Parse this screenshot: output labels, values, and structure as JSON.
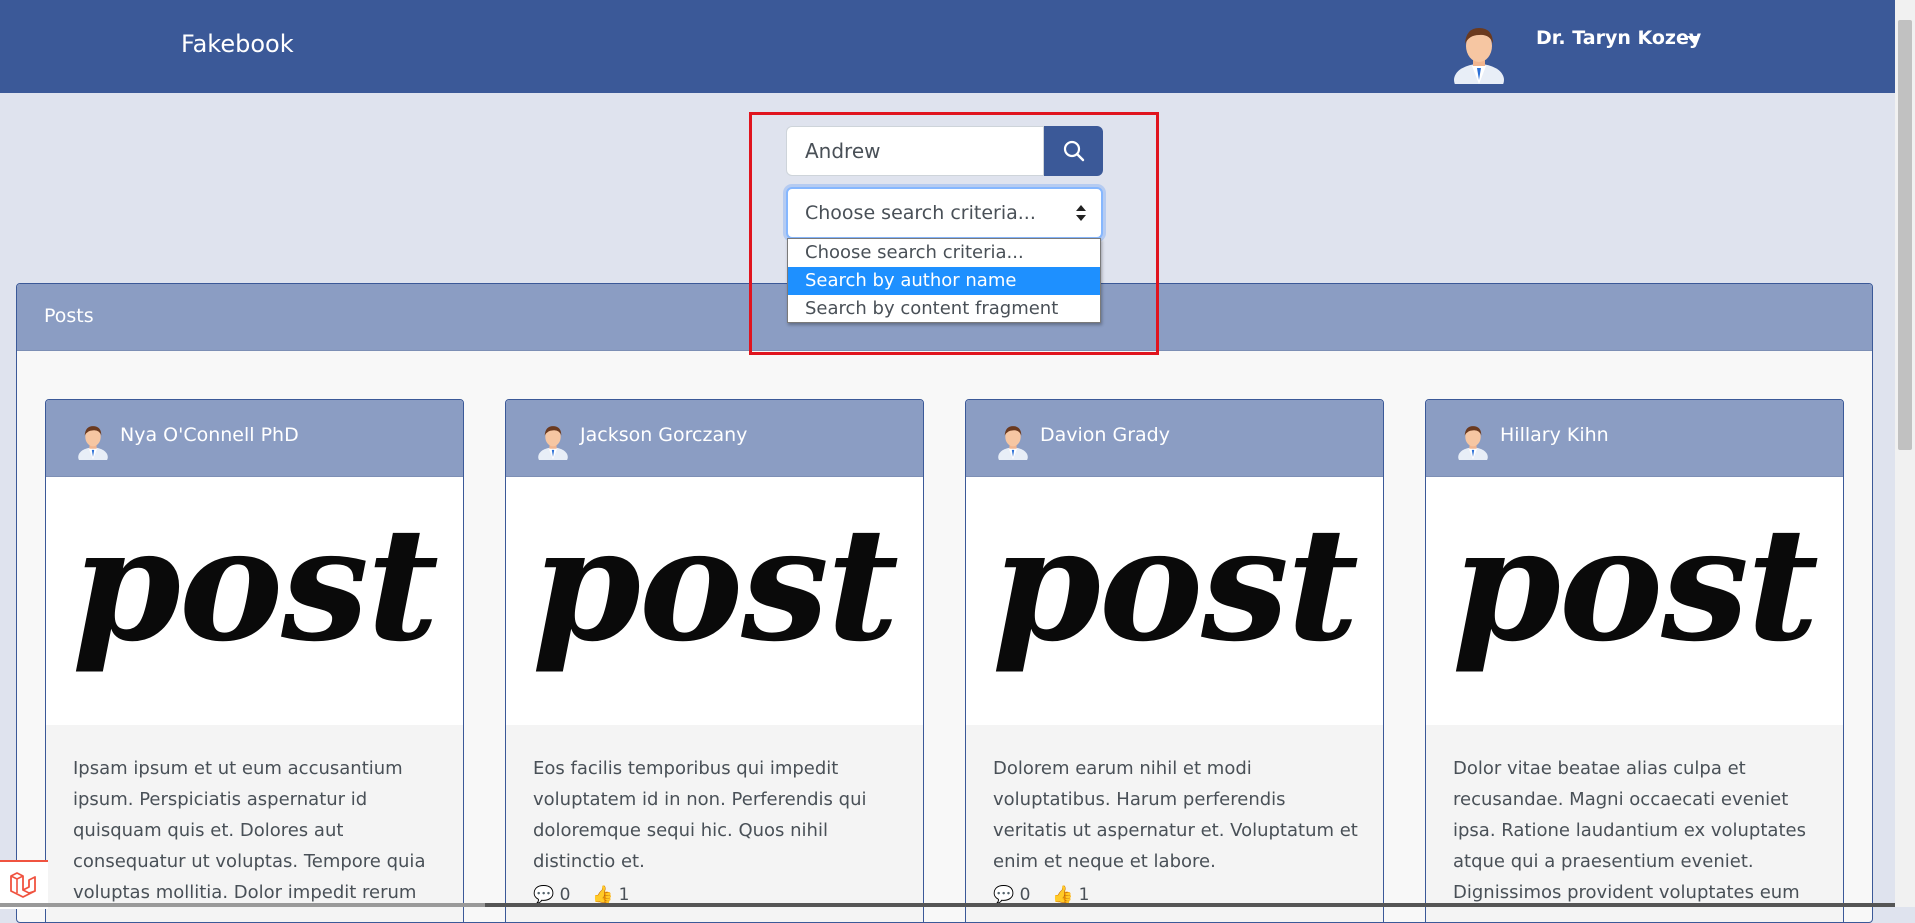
{
  "navbar": {
    "brand": "Fakebook",
    "user_name": "Dr. Taryn Kozey"
  },
  "search": {
    "query": "Andrew",
    "criteria_selected": "Choose search criteria...",
    "options": [
      "Choose search criteria...",
      "Search by author name",
      "Search by content fragment"
    ],
    "highlighted_option": "Search by author name"
  },
  "posts": {
    "title": "Posts",
    "cards": [
      {
        "author": "Nya O'Connell PhD",
        "image_text": "post",
        "text": "Ipsam ipsum et ut eum accusantium ipsum. Perspiciatis aspernatur id quisquam quis et. Dolores aut consequatur ut voluptas. Tempore quia voluptas mollitia. Dolor impedit rerum",
        "comments": "",
        "likes": ""
      },
      {
        "author": "Jackson Gorczany",
        "image_text": "post",
        "text": "Eos facilis temporibus qui impedit voluptatem id in non. Perferendis qui doloremque sequi hic. Quos nihil distinctio et.",
        "comments": "0",
        "likes": "1"
      },
      {
        "author": "Davion Grady",
        "image_text": "post",
        "text": "Dolorem earum nihil et modi voluptatibus. Harum perferendis veritatis ut aspernatur et. Voluptatum et enim et neque et labore.",
        "comments": "0",
        "likes": "1"
      },
      {
        "author": "Hillary Kihn",
        "image_text": "post",
        "text": "Dolor vitae beatae alias culpa et recusandae. Magni occaecati eveniet ipsa. Ratione laudantium ex voluptates atque qui a praesentium eveniet. Dignissimos provident voluptates eum",
        "comments": "",
        "likes": ""
      }
    ]
  },
  "colors": {
    "brand": "#3b5998",
    "header_light": "#8b9dc3",
    "background": "#dfe3ee",
    "highlight_box": "#e0141e",
    "option_selected": "#1e90ff"
  },
  "icons": {
    "search": "search-icon",
    "avatar": "avatar-icon",
    "caret": "caret-down-icon",
    "comment": "comment-icon",
    "like": "thumbs-up-icon",
    "laravel": "laravel-logo-icon"
  }
}
